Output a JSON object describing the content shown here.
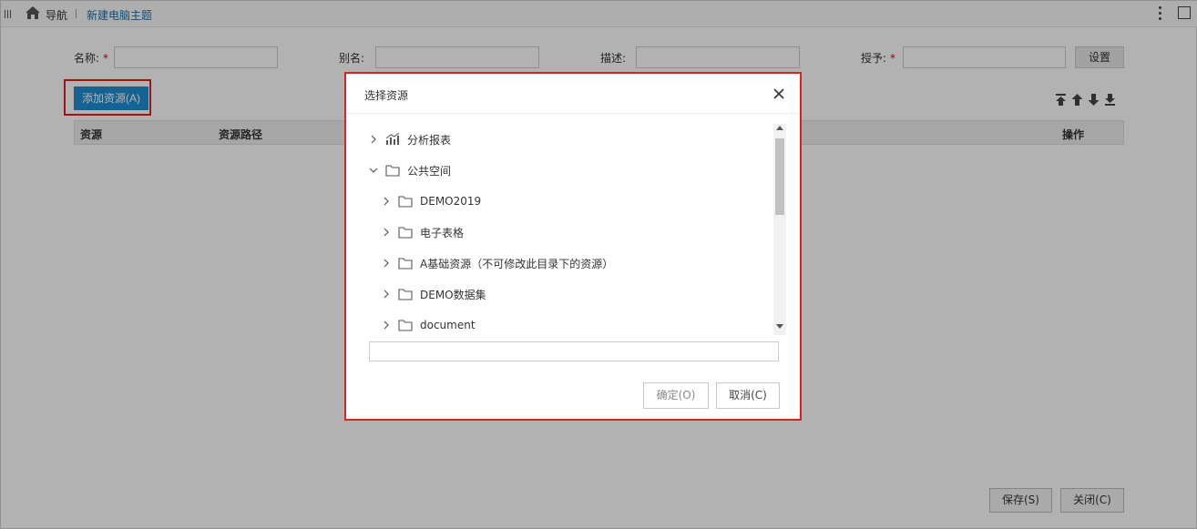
{
  "topbar": {
    "nav_label": "导航",
    "tab_title": "新建电脑主题"
  },
  "form": {
    "name_label": "名称:",
    "alias_label": "别名:",
    "desc_label": "描述:",
    "grant_label": "授予:",
    "required_mark": "*",
    "setting_button": "设置",
    "add_resource_button": "添加资源(A)"
  },
  "table": {
    "columns": [
      "资源",
      "资源路径",
      "操作"
    ]
  },
  "footer": {
    "save_button": "保存(S)",
    "close_button": "关闭(C)"
  },
  "dialog": {
    "title": "选择资源",
    "tree": [
      {
        "label": "分析报表",
        "expanded": false,
        "icon": "analysis-report-icon"
      },
      {
        "label": "公共空间",
        "expanded": true,
        "icon": "folder-icon"
      },
      {
        "label": "DEMO2019",
        "expanded": false,
        "icon": "folder-icon"
      },
      {
        "label": "电子表格",
        "expanded": false,
        "icon": "folder-icon"
      },
      {
        "label": "A基础资源（不可修改此目录下的资源）",
        "expanded": false,
        "icon": "folder-icon"
      },
      {
        "label": "DEMO数据集",
        "expanded": false,
        "icon": "folder-icon"
      },
      {
        "label": "document",
        "expanded": false,
        "icon": "folder-icon"
      }
    ],
    "confirm_button": "确定(O)",
    "cancel_button": "取消(C)"
  },
  "colors": {
    "accent": "#1f8fd1",
    "highlight_border": "#e0201c",
    "link": "#1a6fa8"
  }
}
